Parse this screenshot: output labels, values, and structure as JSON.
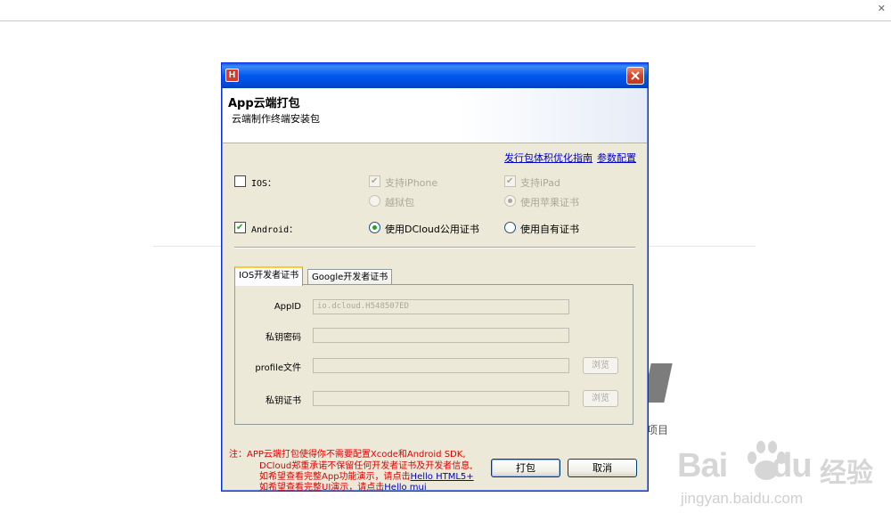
{
  "background": {
    "project_label": "项目",
    "watermark": {
      "brand": "Bai",
      "brand2": "du",
      "suffix": "经验",
      "url": "jingyan.baidu.com"
    }
  },
  "dialog": {
    "app_icon_letter": "H",
    "header": {
      "title": "App云端打包",
      "subtitle": "云端制作终端安装包"
    },
    "links": {
      "guide": "发行包体积优化指南",
      "config": "参数配置"
    },
    "ios": {
      "label": "IOS：",
      "checked": false,
      "support_iphone": {
        "label": "支持iPhone",
        "checked": true
      },
      "support_ipad": {
        "label": "支持iPad",
        "checked": true
      },
      "jailbreak": {
        "label": "越狱包",
        "selected": false
      },
      "apple_cert": {
        "label": "使用苹果证书",
        "selected": true
      }
    },
    "android": {
      "label": "Android：",
      "checked": true,
      "public_cert": {
        "label": "使用DCloud公用证书",
        "selected": true
      },
      "own_cert": {
        "label": "使用自有证书",
        "selected": false
      }
    },
    "tabs": [
      {
        "label": "IOS开发者证书",
        "active": true
      },
      {
        "label": "Google开发者证书",
        "active": false
      }
    ],
    "fields": {
      "appid": {
        "label": "AppID",
        "value": "io.dcloud.H548507ED"
      },
      "key_password": {
        "label": "私钥密码",
        "value": ""
      },
      "profile": {
        "label": "profile文件",
        "value": "",
        "browse": "浏览"
      },
      "key_cert": {
        "label": "私钥证书",
        "value": "",
        "browse": "浏览"
      }
    },
    "note": {
      "line1": "注：APP云端打包使得你不需要配置Xcode和Android SDK,",
      "line2": "DCloud郑重承诺不保留任何开发者证书及开发者信息,",
      "line3_prefix": "如希望查看完整App功能演示，请点击",
      "line3_link": "Hello HTML5+",
      "line4_prefix": "如希望查看完整UI演示，请点击",
      "line4_link": "Hello mui"
    },
    "buttons": {
      "pack": "打包",
      "cancel": "取消"
    },
    "colors": {
      "title_bar": "#0058ee",
      "note_text": "#e00000",
      "link": "#0000cc",
      "check": "#21a121"
    }
  }
}
